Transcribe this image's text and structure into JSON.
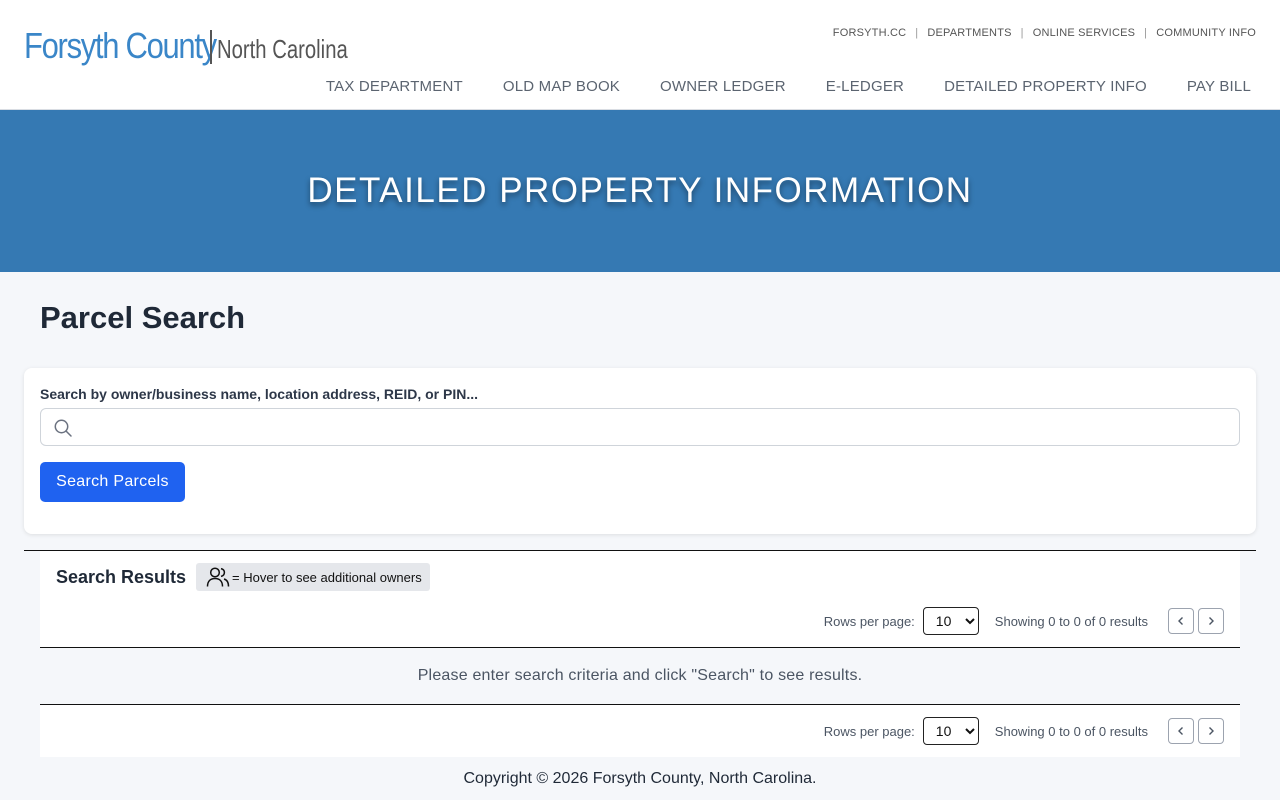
{
  "brand": {
    "name": "Forsyth County",
    "state": "North Carolina",
    "colors": {
      "primary": "#3a86c8",
      "hero": "#3579b3",
      "button": "#1f62f0"
    }
  },
  "utility_nav": [
    "FORSYTH.CC",
    "DEPARTMENTS",
    "ONLINE SERVICES",
    "COMMUNITY INFO"
  ],
  "main_nav": [
    "TAX DEPARTMENT",
    "OLD MAP BOOK",
    "OWNER LEDGER",
    "E-LEDGER",
    "DETAILED PROPERTY INFO",
    "PAY BILL"
  ],
  "hero": {
    "title": "DETAILED PROPERTY INFORMATION"
  },
  "page": {
    "title": "Parcel Search"
  },
  "search": {
    "label": "Search by owner/business name, location address, REID, or PIN...",
    "value": "",
    "icon": "search-icon",
    "button_label": "Search Parcels"
  },
  "results": {
    "title": "Search Results",
    "legend_text": "= Hover to see additional owners",
    "legend_icon": "users-icon",
    "rows_per_page_label": "Rows per page:",
    "rows_per_page_value": "10",
    "rows_per_page_options": [
      "10"
    ],
    "showing_text": "Showing 0 to 0 of 0 results",
    "empty_message": "Please enter search criteria and click \"Search\" to see results."
  },
  "footer": {
    "copyright": "Copyright © 2026 Forsyth County, North Carolina."
  }
}
